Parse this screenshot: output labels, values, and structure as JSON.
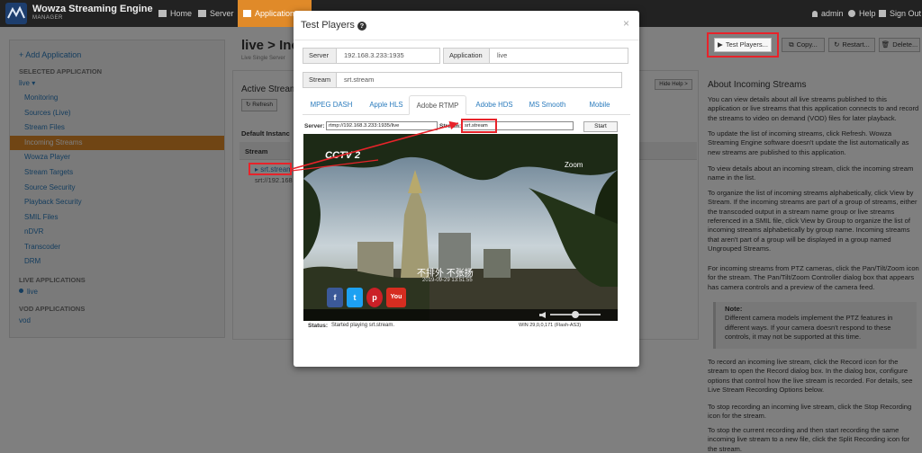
{
  "brand": {
    "name": "Wowza Streaming Engine",
    "sub": "MANAGER"
  },
  "nav": {
    "home": "Home",
    "server": "Server",
    "applications": "Applications",
    "user": "admin",
    "help": "Help",
    "signout": "Sign Out"
  },
  "sidebar": {
    "add_app": "+ Add Application",
    "selected_head": "SELECTED APPLICATION",
    "selected_app": "live ▾",
    "items": [
      "Monitoring",
      "Sources (Live)",
      "Stream Files",
      "Incoming Streams",
      "Wowza Player",
      "Stream Targets",
      "Source Security",
      "Playback Security",
      "SMIL Files",
      "nDVR",
      "Transcoder",
      "DRM"
    ],
    "live_head": "LIVE APPLICATIONS",
    "live_app": "live",
    "vod_head": "VOD APPLICATIONS",
    "vod_app": "vod"
  },
  "main": {
    "title": "live > Inc",
    "subtitle": "Live Single Server",
    "section": "Active Stream",
    "refresh": "Refresh",
    "default_instance": "Default Instanc",
    "stream_col": "Stream",
    "stream_link": "srt.stream",
    "stream_sub": "srt://192.168",
    "hide_help": "Hide Help >"
  },
  "toolbar": {
    "test_players": "Test Players...",
    "copy": "Copy...",
    "restart": "Restart...",
    "delete": "Delete..."
  },
  "help": {
    "title": "About Incoming Streams",
    "p1": "You can view details about all live streams published to this application or live streams that this application connects to and record the streams to video on demand (VOD) files for later playback.",
    "p2": "To update the list of incoming streams, click Refresh. Wowza Streaming Engine software doesn't update the list automatically as new streams are published to this application.",
    "p3": "To view details about an incoming stream, click the incoming stream name in the list.",
    "p4": "To organize the list of incoming streams alphabetically, click View by Stream. If the incoming streams are part of a group of streams, either the transcoded output in a stream name group or live streams referenced in a SMIL file, click View by Group to organize the list of incoming streams alphabetically by group name. Incoming streams that aren't part of a group will be displayed in a group named Ungrouped Streams.",
    "p5": "For incoming streams from PTZ cameras, click the Pan/Tilt/Zoom icon for the stream. The Pan/Tilt/Zoom Controller dialog box that appears has camera controls and a preview of the camera feed.",
    "note_title": "Note:",
    "note": "Different camera models implement the PTZ features in different ways. If your camera doesn't respond to these controls, it may not be supported at this time.",
    "p6": "To record an incoming live stream, click the Record icon for the stream to open the Record dialog box. In the dialog box, configure options that control how the live stream is recorded. For details, see Live Stream Recording Options below.",
    "p7": "To stop recording an incoming live stream, click the Stop Recording icon for the stream.",
    "p8": "To stop the current recording and then start recording the same incoming live stream to a new file, click the Split Recording icon for the stream."
  },
  "modal": {
    "title": "Test Players",
    "close": "×",
    "server_label": "Server",
    "server_value": "192.168.3.233:1935",
    "application_label": "Application",
    "application_value": "live",
    "stream_label": "Stream",
    "stream_value": "srt.stream",
    "tabs": [
      "MPEG DASH",
      "Apple HLS",
      "Adobe RTMP",
      "Adobe HDS",
      "MS Smooth",
      "Mobile"
    ],
    "player": {
      "server_label": "Server:",
      "server_value": "rtmp://192.168.3.233:1935/live",
      "stream_label": "Stream:",
      "stream_value": "srt.stream",
      "start": "Start",
      "status_label": "Status:",
      "status_value": "Started playing srt.stream.",
      "version": "WIN 29,0,0,171 (Flash-AS3)"
    },
    "video": {
      "channel": "CCTV 2",
      "zoom": "Zoom",
      "caption": "不排外 不张扬",
      "timestamp": "2019-09-29 13:51:55",
      "social": [
        "f",
        "t",
        "p",
        "You"
      ]
    }
  }
}
